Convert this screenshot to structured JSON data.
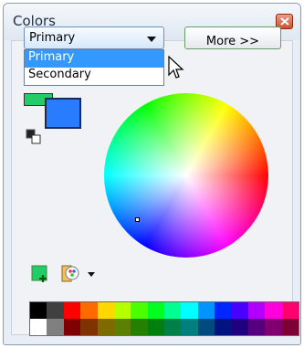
{
  "window": {
    "title": "Colors"
  },
  "color_mode": {
    "selected": "Primary",
    "options": [
      "Primary",
      "Secondary"
    ]
  },
  "more_button": {
    "label": "More >>"
  },
  "colors": {
    "primary": "#2a7cff",
    "secondary": "#22cc66",
    "accent_highlight": "#3399ff"
  },
  "icons": {
    "close": "close-icon",
    "swap": "swap-colors-icon",
    "add": "add-color-icon",
    "palette": "palette-icon",
    "palette_dropdown": "chevron-down-icon"
  },
  "palette": {
    "row1": [
      "#000000",
      "#404040",
      "#ff0000",
      "#ff6a00",
      "#ffd800",
      "#b6ff00",
      "#4cff00",
      "#00ff21",
      "#00ff90",
      "#00ffff",
      "#0094ff",
      "#0026ff",
      "#4800ff",
      "#b200ff",
      "#ff00dc",
      "#ff006e"
    ],
    "row2": [
      "#ffffff",
      "#808080",
      "#7f0000",
      "#7f3300",
      "#7f6a00",
      "#5b7f00",
      "#267f00",
      "#007f0e",
      "#007f46",
      "#007f7f",
      "#004a7f",
      "#00137f",
      "#21007f",
      "#57007f",
      "#7f006e",
      "#7f0037"
    ]
  }
}
